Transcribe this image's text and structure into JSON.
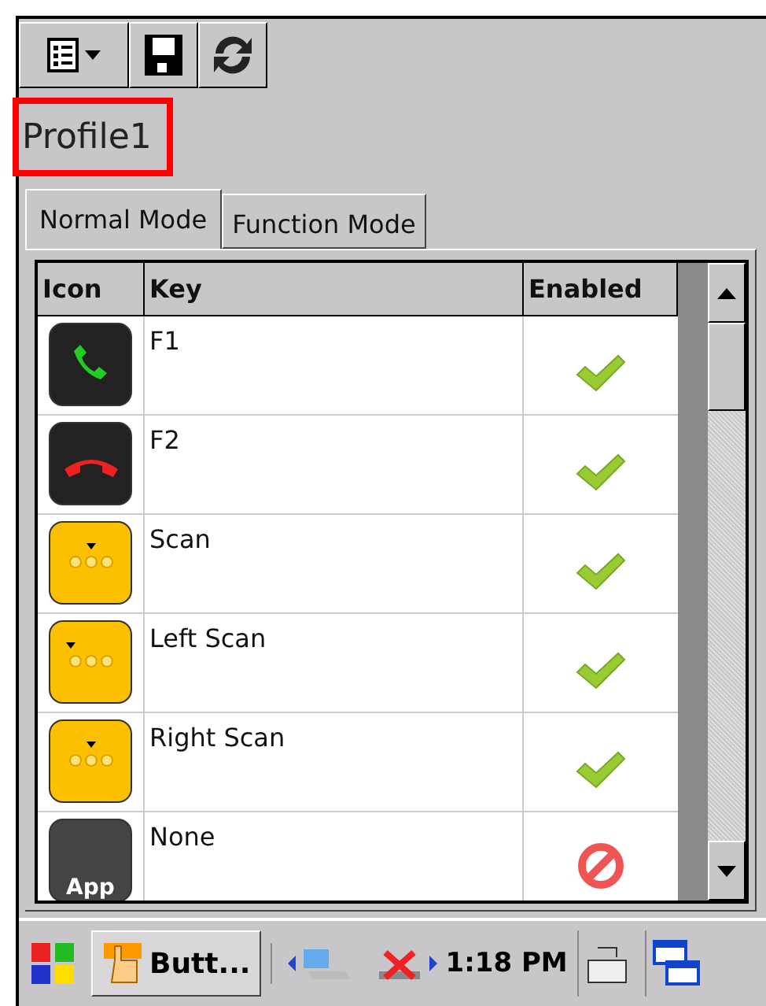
{
  "toolbar": {
    "buttons": [
      {
        "kind": "list"
      },
      {
        "kind": "save"
      },
      {
        "kind": "refresh"
      }
    ]
  },
  "profile": {
    "name": "Profile1",
    "highlighted": true
  },
  "tabs": [
    {
      "label": "Normal Mode",
      "selected": true
    },
    {
      "label": "Function Mode",
      "selected": false
    }
  ],
  "table": {
    "columns": [
      "Icon",
      "Key",
      "Enabled"
    ],
    "rows": [
      {
        "kind": "call",
        "key": "F1",
        "enabled": true
      },
      {
        "kind": "end",
        "key": "F2",
        "enabled": true
      },
      {
        "kind": "scan",
        "key": "Scan",
        "enabled": true
      },
      {
        "kind": "left",
        "key": "Left Scan",
        "enabled": true
      },
      {
        "kind": "right",
        "key": "Right Scan",
        "enabled": true
      },
      {
        "kind": "app",
        "icon_text": "App",
        "key": "None",
        "enabled": false
      }
    ]
  },
  "taskbar": {
    "task": "Butt...",
    "time": "1:18 PM"
  }
}
